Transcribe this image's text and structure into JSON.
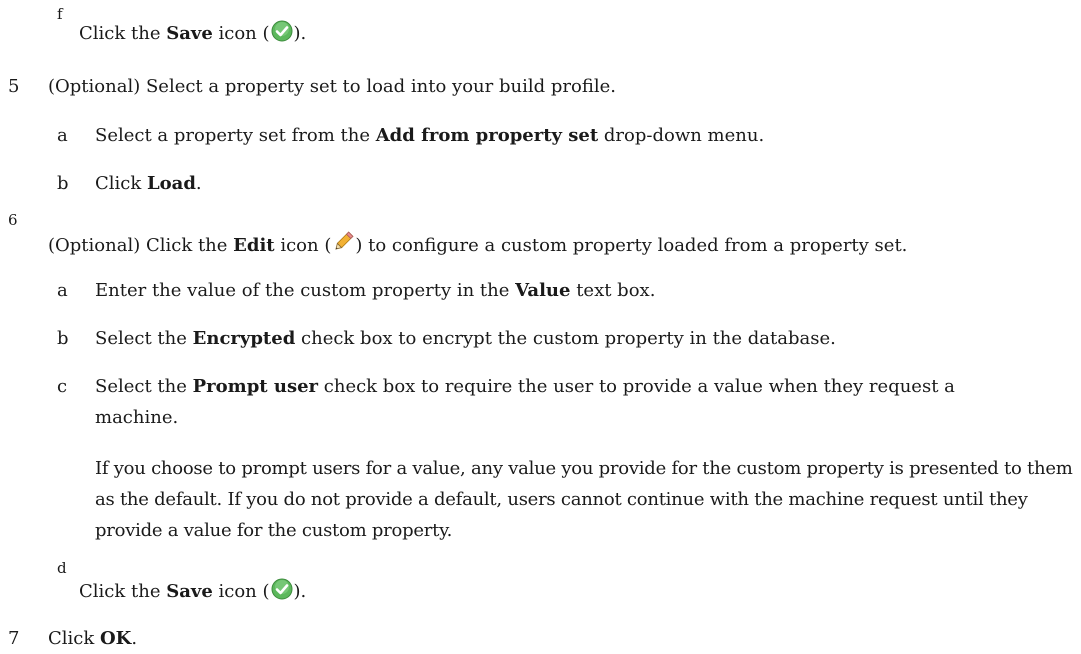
{
  "steps": {
    "f_save": {
      "marker": "f",
      "prefix": "Click the ",
      "bold": "Save",
      "mid": " icon (",
      "suffix": ")."
    },
    "step5": {
      "number": "5",
      "text": "(Optional) Select a property set to load into your build profile."
    },
    "step5a": {
      "marker": "a",
      "prefix": "Select a property set from the ",
      "bold": "Add from property set",
      "suffix": " drop-down menu."
    },
    "step5b": {
      "marker": "b",
      "prefix": "Click ",
      "bold": "Load",
      "suffix": "."
    },
    "step6": {
      "number": "6",
      "prefix": "(Optional) Click the ",
      "bold": "Edit",
      "mid": " icon (",
      "suffix": ") to configure a custom property loaded from a property set."
    },
    "step6a": {
      "marker": "a",
      "prefix": "Enter the value of the custom property in the ",
      "bold": "Value",
      "suffix": " text box."
    },
    "step6b": {
      "marker": "b",
      "prefix": "Select the ",
      "bold": "Encrypted",
      "suffix": " check box to encrypt the custom property in the database."
    },
    "step6c": {
      "marker": "c",
      "prefix": "Select the ",
      "bold": "Prompt user",
      "suffix": " check box to require the user to provide a value when they request a",
      "continuation": "machine."
    },
    "step6c_note": {
      "text": "If you choose to prompt users for a value, any value you provide for the custom property is presented to them as the default. If you do not provide a default, users cannot continue with the machine request until they provide a value for the custom property."
    },
    "step6d": {
      "marker": "d",
      "prefix": "Click the ",
      "bold": "Save",
      "mid": " icon (",
      "suffix": ")."
    },
    "step7": {
      "number": "7",
      "prefix": "Click ",
      "bold": "OK",
      "suffix": "."
    }
  },
  "icons": {
    "save": "check-circle-icon",
    "edit": "pencil-icon",
    "save_color": "#5cb85c",
    "edit_color": "#f0b030"
  }
}
